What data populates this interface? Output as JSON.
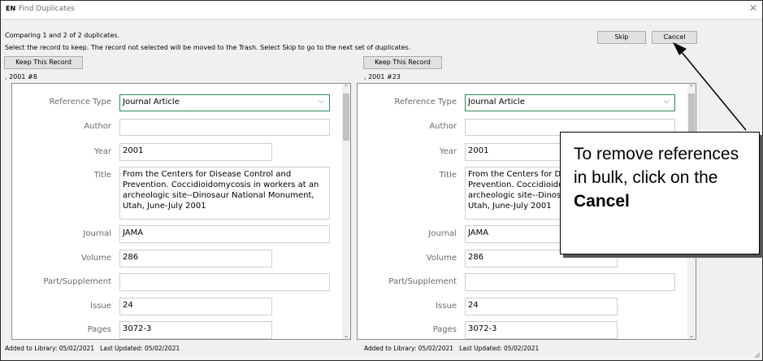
{
  "window": {
    "logo": "EN",
    "title": "Find Duplicates"
  },
  "info": {
    "line1": "Comparing 1 and 2 of 2 duplicates.",
    "line2": "Select the record to keep. The record not selected will be moved to the Trash. Select Skip to go to the next set of duplicates."
  },
  "buttons": {
    "skip": "Skip",
    "cancel": "Cancel",
    "keep": "Keep This Record"
  },
  "left": {
    "record_label": ", 2001 #8",
    "fields": {
      "reference_type": {
        "label": "Reference Type",
        "value": "Journal Article"
      },
      "author": {
        "label": "Author",
        "value": ""
      },
      "year": {
        "label": "Year",
        "value": "2001"
      },
      "title": {
        "label": "Title",
        "value": "From the Centers for Disease Control and Prevention. Coccidioidomycosis in workers at an archeologic site--Dinosaur National Monument, Utah, June-July 2001"
      },
      "journal": {
        "label": "Journal",
        "value": "JAMA"
      },
      "volume": {
        "label": "Volume",
        "value": "286"
      },
      "part": {
        "label": "Part/Supplement",
        "value": ""
      },
      "issue": {
        "label": "Issue",
        "value": "24"
      },
      "pages": {
        "label": "Pages",
        "value": "3072-3"
      }
    },
    "status": {
      "added": "Added to Library: 05/02/2021",
      "updated": "Last Updated: 05/02/2021"
    }
  },
  "right": {
    "record_label": ", 2001 #23",
    "fields": {
      "reference_type": {
        "label": "Reference Type",
        "value": "Journal Article"
      },
      "author": {
        "label": "Author",
        "value": ""
      },
      "year": {
        "label": "Year",
        "value": "2001"
      },
      "title": {
        "label": "Title",
        "value": "From the Centers for Disease Control and Prevention. Coccidioidomycosis in workers at an archeologic site--Dinosaur National Monument, Utah, June-July 2001"
      },
      "journal": {
        "label": "Journal",
        "value": "JAMA"
      },
      "volume": {
        "label": "Volume",
        "value": "286"
      },
      "part": {
        "label": "Part/Supplement",
        "value": ""
      },
      "issue": {
        "label": "Issue",
        "value": "24"
      },
      "pages": {
        "label": "Pages",
        "value": "3072-3"
      }
    },
    "status": {
      "added": "Added to Library: 05/02/2021",
      "updated": "Last Updated: 05/02/2021"
    }
  },
  "callout": {
    "text": "To remove references in bulk, click on the",
    "bold": "Cancel"
  },
  "icons": {
    "close": "close-icon",
    "dropdown": "chevron-down-icon",
    "scroll_up": "chevron-up-icon",
    "scroll_down": "chevron-down-icon",
    "grip": "resize-grip-icon"
  },
  "colors": {
    "select_border": "#2e8b57",
    "window_bg": "#f0f0f0"
  }
}
